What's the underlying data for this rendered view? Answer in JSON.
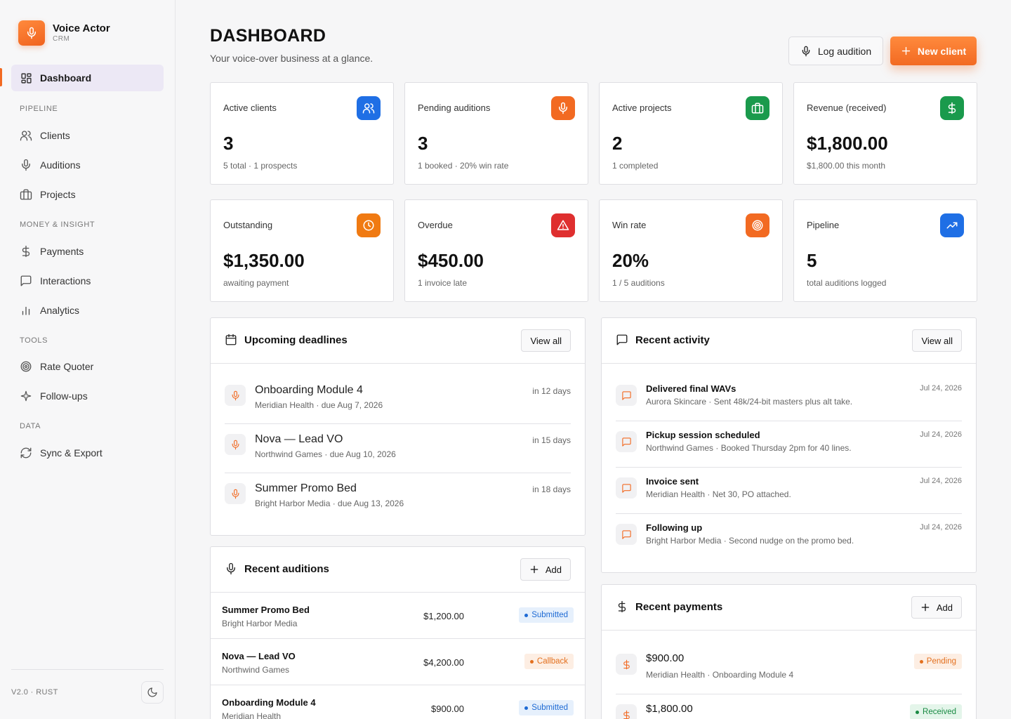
{
  "brand": {
    "name": "Voice Actor",
    "sub": "CRM"
  },
  "sidebar": {
    "dashboard": "Dashboard",
    "sections": {
      "pipeline": "PIPELINE",
      "money": "MONEY & INSIGHT",
      "tools": "TOOLS",
      "data": "DATA"
    },
    "clients": "Clients",
    "auditions": "Auditions",
    "projects": "Projects",
    "payments": "Payments",
    "interactions": "Interactions",
    "analytics": "Analytics",
    "rate_quoter": "Rate Quoter",
    "follow_ups": "Follow-ups",
    "sync_export": "Sync & Export",
    "version": "V2.0 · RUST"
  },
  "header": {
    "title": "DASHBOARD",
    "subtitle": "Your voice-over business at a glance.",
    "log_audition": "Log audition",
    "new_client": "New client"
  },
  "stats": [
    {
      "label": "Active clients",
      "value": "3",
      "note": "5 total · 1 prospects",
      "icon": "users-icon",
      "color": "#1f6fe5"
    },
    {
      "label": "Pending auditions",
      "value": "3",
      "note": "1 booked · 20% win rate",
      "icon": "mic-icon",
      "color": "#f26a22"
    },
    {
      "label": "Active projects",
      "value": "2",
      "note": "1 completed",
      "icon": "briefcase-icon",
      "color": "#1a9a4c"
    },
    {
      "label": "Revenue (received)",
      "value": "$1,800.00",
      "note": "$1,800.00 this month",
      "icon": "dollar-icon",
      "color": "#1a9a4c"
    },
    {
      "label": "Outstanding",
      "value": "$1,350.00",
      "note": "awaiting payment",
      "icon": "clock-icon",
      "color": "#f07a12"
    },
    {
      "label": "Overdue",
      "value": "$450.00",
      "note": "1 invoice late",
      "icon": "alert-icon",
      "color": "#df2f2f"
    },
    {
      "label": "Win rate",
      "value": "20%",
      "note": "1 / 5 auditions",
      "icon": "target-icon",
      "color": "#f26a22"
    },
    {
      "label": "Pipeline",
      "value": "5",
      "note": "total auditions logged",
      "icon": "trending-icon",
      "color": "#1f6fe5"
    }
  ],
  "deadlines": {
    "title": "Upcoming deadlines",
    "view_all": "View all",
    "items": [
      {
        "title": "Onboarding Module 4",
        "meta": "Meridian Health · due Aug 7, 2026",
        "when": "in 12 days"
      },
      {
        "title": "Nova — Lead VO",
        "meta": "Northwind Games · due Aug 10, 2026",
        "when": "in 15 days"
      },
      {
        "title": "Summer Promo Bed",
        "meta": "Bright Harbor Media · due Aug 13, 2026",
        "when": "in 18 days"
      }
    ]
  },
  "activity": {
    "title": "Recent activity",
    "view_all": "View all",
    "items": [
      {
        "title": "Delivered final WAVs",
        "meta": "Aurora Skincare · Sent 48k/24-bit masters plus alt take.",
        "date": "Jul 24, 2026"
      },
      {
        "title": "Pickup session scheduled",
        "meta": "Northwind Games · Booked Thursday 2pm for 40 lines.",
        "date": "Jul 24, 2026"
      },
      {
        "title": "Invoice sent",
        "meta": "Meridian Health · Net 30, PO attached.",
        "date": "Jul 24, 2026"
      },
      {
        "title": "Following up",
        "meta": "Bright Harbor Media · Second nudge on the promo bed.",
        "date": "Jul 24, 2026"
      }
    ]
  },
  "auditions": {
    "title": "Recent auditions",
    "add": "Add",
    "items": [
      {
        "title": "Summer Promo Bed",
        "client": "Bright Harbor Media",
        "amount": "$1,200.00",
        "status": "Submitted"
      },
      {
        "title": "Nova — Lead VO",
        "client": "Northwind Games",
        "amount": "$4,200.00",
        "status": "Callback"
      },
      {
        "title": "Onboarding Module 4",
        "client": "Meridian Health",
        "amount": "$900.00",
        "status": "Submitted"
      }
    ]
  },
  "payments": {
    "title": "Recent payments",
    "add": "Add",
    "items": [
      {
        "amount": "$900.00",
        "meta": "Meridian Health · Onboarding Module 4",
        "status": "Pending"
      },
      {
        "amount": "$1,800.00",
        "meta": "",
        "status": "Received"
      }
    ]
  }
}
